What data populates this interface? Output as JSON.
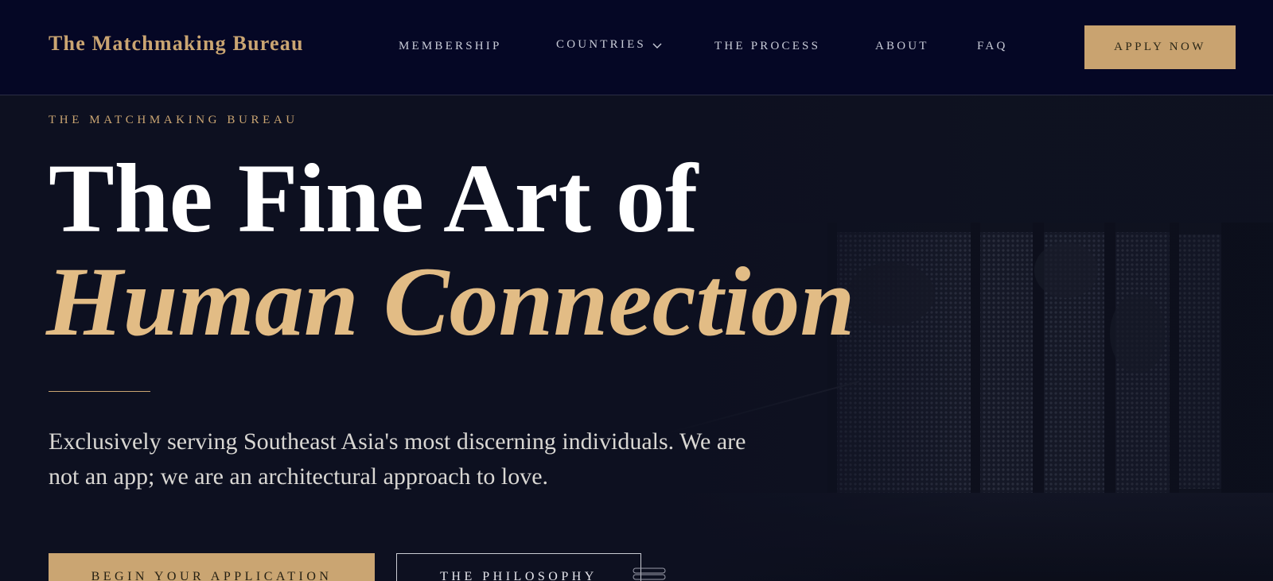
{
  "header": {
    "logo": "The Matchmaking Bureau",
    "nav": {
      "membership": "MEMBERSHIP",
      "countries": "COUNTRIES",
      "process": "THE PROCESS",
      "about": "ABOUT",
      "faq": "FAQ"
    },
    "apply_label": "APPLY NOW"
  },
  "hero": {
    "eyebrow": "THE MATCHMAKING BUREAU",
    "title_line1": "The Fine Art of",
    "title_line2": "Human Connection",
    "lead": "Exclusively serving Southeast Asia's most discerning individuals. We are not an app; we are an architectural approach to love.",
    "cta_primary": "BEGIN YOUR APPLICATION",
    "cta_secondary": "THE PHILOSOPHY"
  },
  "icons": {
    "countries_dropdown": "chevron-down-icon"
  },
  "colors": {
    "header_bg": "#050725",
    "page_bg": "#0d1020",
    "gold": "#caa572",
    "gold_light": "#e2bc85",
    "text_light": "#d9d7d3"
  }
}
